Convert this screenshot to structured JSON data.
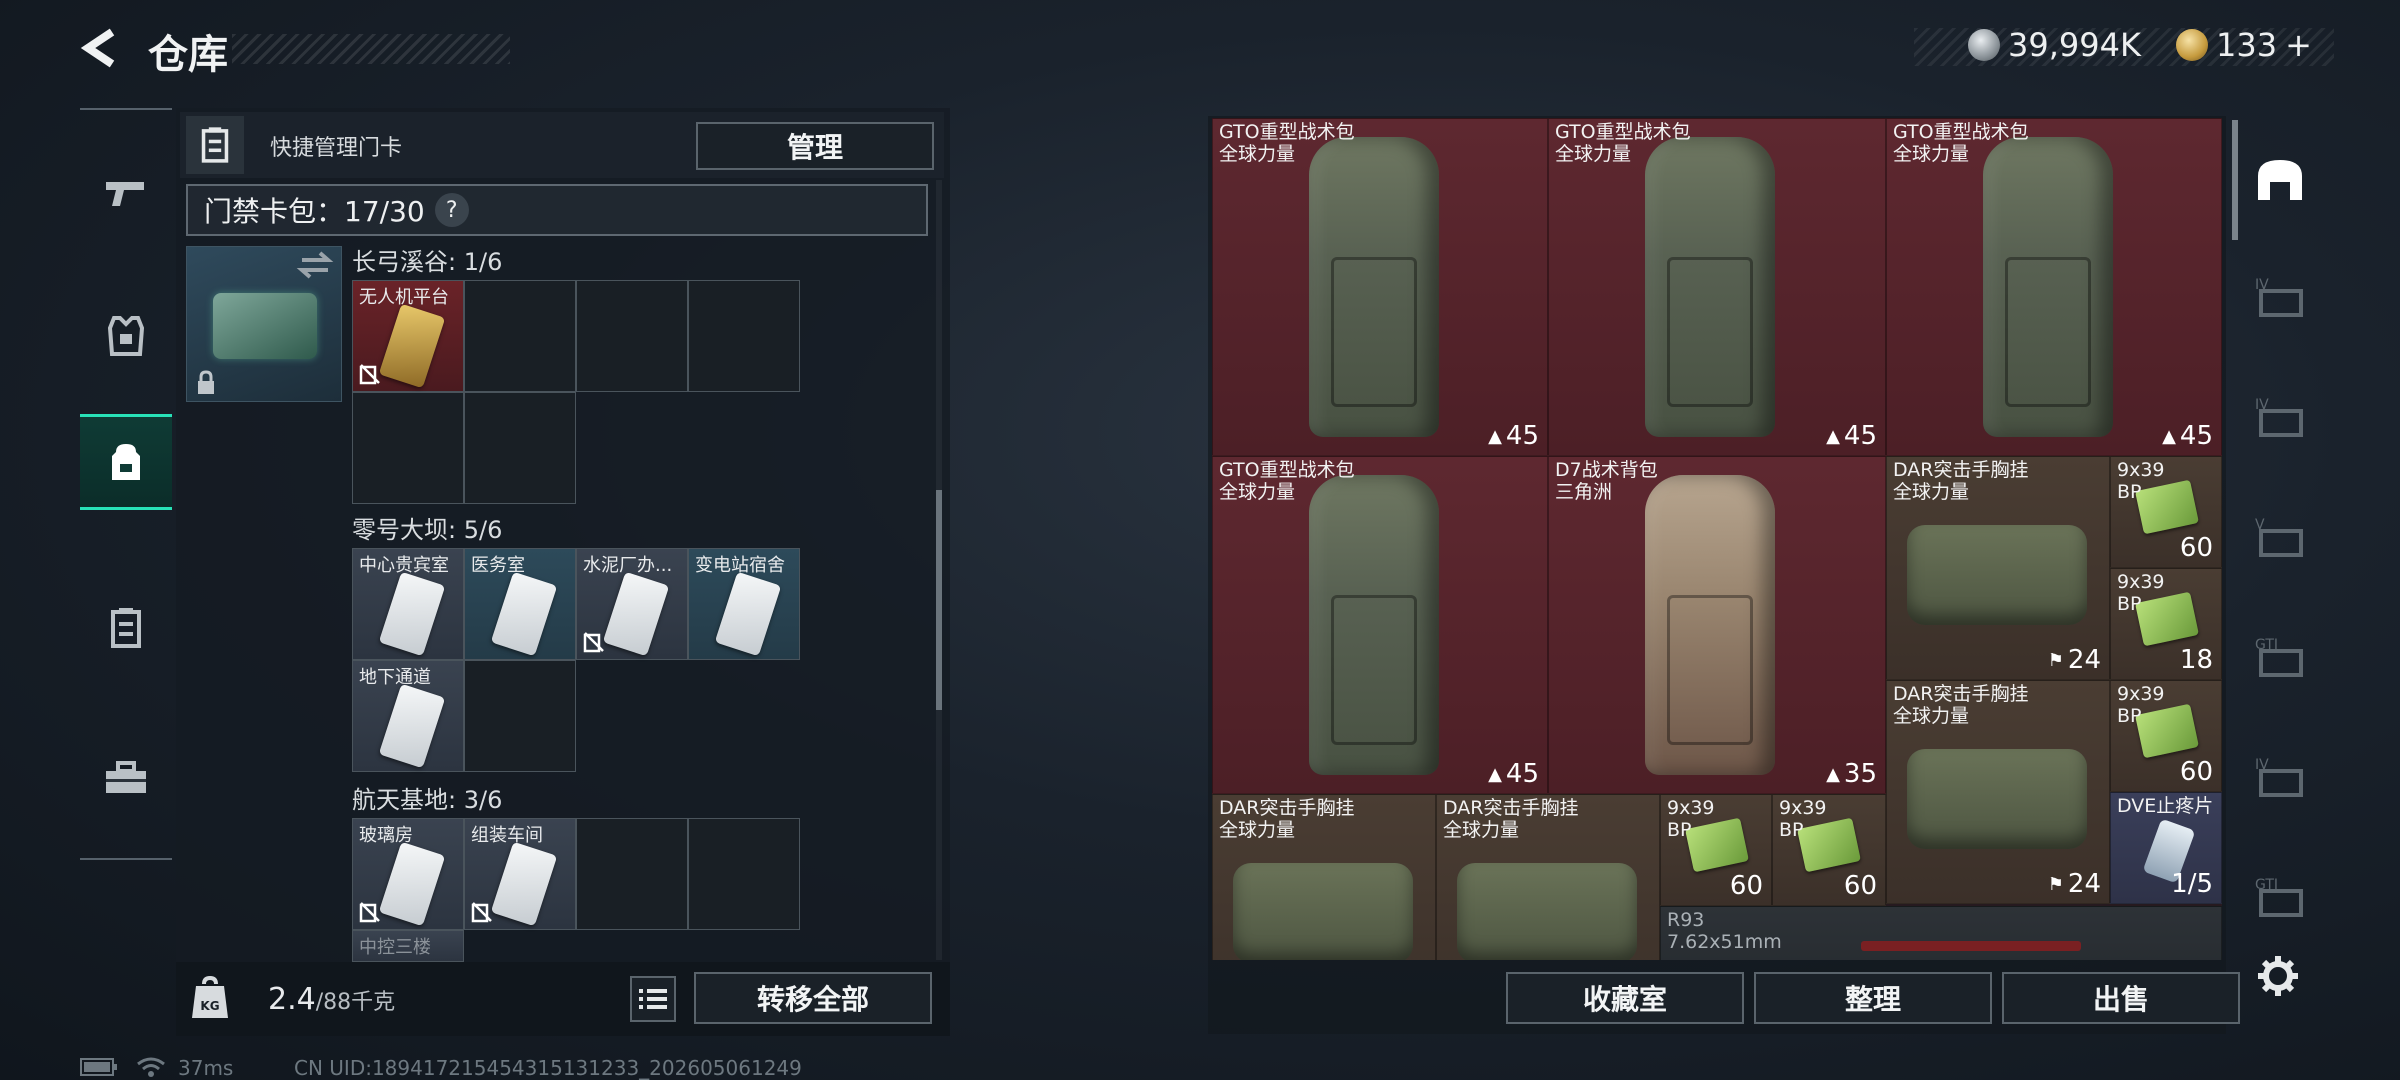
{
  "header": {
    "title": "仓库",
    "currency_1": "39,994K",
    "currency_2": "133",
    "currency_plus": "+"
  },
  "left_nav": [
    "weapon-icon",
    "armor-icon",
    "backpack-icon",
    "keycard-icon",
    "toolbox-icon"
  ],
  "quick": {
    "label": "快捷管理门卡",
    "manage_button": "管理"
  },
  "cardpack": {
    "label": "门禁卡包：17/30",
    "help": "?"
  },
  "sections": [
    {
      "title": "长弓溪谷: 1/6",
      "cards": [
        {
          "label": "无人机平台"
        }
      ]
    },
    {
      "title": "零号大坝: 5/6",
      "cards": [
        {
          "label": "中心贵宾室"
        },
        {
          "label": "医务室"
        },
        {
          "label": "水泥厂办..."
        },
        {
          "label": "变电站宿舍"
        },
        {
          "label": "地下通道"
        }
      ]
    },
    {
      "title": "航天基地: 3/6",
      "cards": [
        {
          "label": "玻璃房"
        },
        {
          "label": "组装车间"
        },
        {
          "label": "中控三楼"
        }
      ]
    }
  ],
  "weight": {
    "value": "2.4",
    "max": "/88千克"
  },
  "transfer_button": "转移全部",
  "stash": {
    "items": [
      {
        "name": "GTO重型战术包\n全球力量",
        "count": "45"
      },
      {
        "name": "GTO重型战术包\n全球力量",
        "count": "45"
      },
      {
        "name": "GTO重型战术包\n全球力量",
        "count": "45"
      },
      {
        "name": "GTO重型战术包\n全球力量",
        "count": "45"
      },
      {
        "name": "D7战术背包\n三角洲",
        "count": "35"
      },
      {
        "name": "DAR突击手胸挂\n全球力量",
        "count": "24"
      },
      {
        "name": "9x39\nBP",
        "count": "60"
      },
      {
        "name": "9x39\nBP",
        "count": "18"
      },
      {
        "name": "DAR突击手胸挂\n全球力量",
        "count": "24"
      },
      {
        "name": "9x39\nBP",
        "count": "60"
      },
      {
        "name": "DAR突击手胸挂\n全球力量",
        "count": ""
      },
      {
        "name": "DAR突击手胸挂\n全球力量",
        "count": ""
      },
      {
        "name": "9x39\nBP",
        "count": "60"
      },
      {
        "name": "9x39\nBP",
        "count": "60"
      },
      {
        "name": "DVE止疼片",
        "count": "1/5"
      },
      {
        "name": "R93\n7.62x51mm",
        "count": ""
      }
    ]
  },
  "buttons": {
    "collection": "收藏室",
    "sort": "整理",
    "sell": "出售"
  },
  "status_bar": {
    "ping": "37ms",
    "uid": "CN UID:189417215454315131233_202605061249"
  }
}
